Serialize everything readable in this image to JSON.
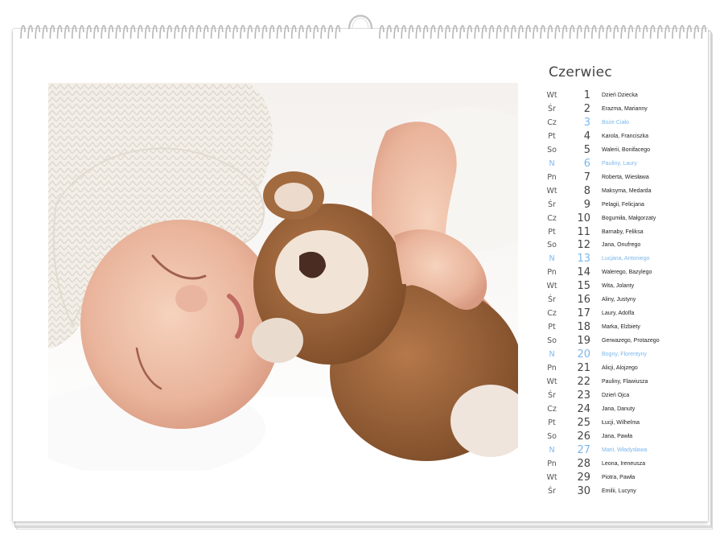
{
  "calendar": {
    "month": "Czerwiec",
    "accent_color": "#7cb7ec",
    "days": [
      {
        "wd": "Wt",
        "num": "1",
        "names": "Dzień Dziecka",
        "type": "normal"
      },
      {
        "wd": "Śr",
        "num": "2",
        "names": "Erazma, Marianny",
        "type": "normal"
      },
      {
        "wd": "Cz",
        "num": "3",
        "names": "Boże Ciało",
        "type": "holiday"
      },
      {
        "wd": "Pt",
        "num": "4",
        "names": "Karola, Franciszka",
        "type": "normal"
      },
      {
        "wd": "So",
        "num": "5",
        "names": "Walerii, Bonifacego",
        "type": "normal"
      },
      {
        "wd": "N",
        "num": "6",
        "names": "Pauliny, Laury",
        "type": "sunday"
      },
      {
        "wd": "Pn",
        "num": "7",
        "names": "Roberta, Wiesława",
        "type": "normal"
      },
      {
        "wd": "Wt",
        "num": "8",
        "names": "Maksyma, Medarda",
        "type": "normal"
      },
      {
        "wd": "Śr",
        "num": "9",
        "names": "Pelagii, Felicjana",
        "type": "normal"
      },
      {
        "wd": "Cz",
        "num": "10",
        "names": "Bogumiła, Małgorzaty",
        "type": "normal"
      },
      {
        "wd": "Pt",
        "num": "11",
        "names": "Barnaby, Feliksa",
        "type": "normal"
      },
      {
        "wd": "So",
        "num": "12",
        "names": "Jana, Onufrego",
        "type": "normal"
      },
      {
        "wd": "N",
        "num": "13",
        "names": "Lucjana, Antoniego",
        "type": "sunday"
      },
      {
        "wd": "Pn",
        "num": "14",
        "names": "Walerego, Bazylego",
        "type": "normal"
      },
      {
        "wd": "Wt",
        "num": "15",
        "names": "Wita, Jolanty",
        "type": "normal"
      },
      {
        "wd": "Śr",
        "num": "16",
        "names": "Aliny, Justyny",
        "type": "normal"
      },
      {
        "wd": "Cz",
        "num": "17",
        "names": "Laury, Adolfa",
        "type": "normal"
      },
      {
        "wd": "Pt",
        "num": "18",
        "names": "Marka, Elżbiety",
        "type": "normal"
      },
      {
        "wd": "So",
        "num": "19",
        "names": "Gerwazego, Protazego",
        "type": "normal"
      },
      {
        "wd": "N",
        "num": "20",
        "names": "Bogny, Florentyny",
        "type": "sunday"
      },
      {
        "wd": "Pn",
        "num": "21",
        "names": "Alicji, Alojzego",
        "type": "normal"
      },
      {
        "wd": "Wt",
        "num": "22",
        "names": "Pauliny, Flawiusza",
        "type": "normal"
      },
      {
        "wd": "Śr",
        "num": "23",
        "names": "Dzień Ojca",
        "type": "normal"
      },
      {
        "wd": "Cz",
        "num": "24",
        "names": "Jana, Danuty",
        "type": "normal"
      },
      {
        "wd": "Pt",
        "num": "25",
        "names": "Łucji, Wilhelma",
        "type": "normal"
      },
      {
        "wd": "So",
        "num": "26",
        "names": "Jana, Pawła",
        "type": "normal"
      },
      {
        "wd": "N",
        "num": "27",
        "names": "Marii, Władysława",
        "type": "sunday"
      },
      {
        "wd": "Pn",
        "num": "28",
        "names": "Leona, Ireneusza",
        "type": "normal"
      },
      {
        "wd": "Wt",
        "num": "29",
        "names": "Piotra, Pawła",
        "type": "normal"
      },
      {
        "wd": "Śr",
        "num": "30",
        "names": "Emilii, Lucyny",
        "type": "normal"
      }
    ]
  }
}
